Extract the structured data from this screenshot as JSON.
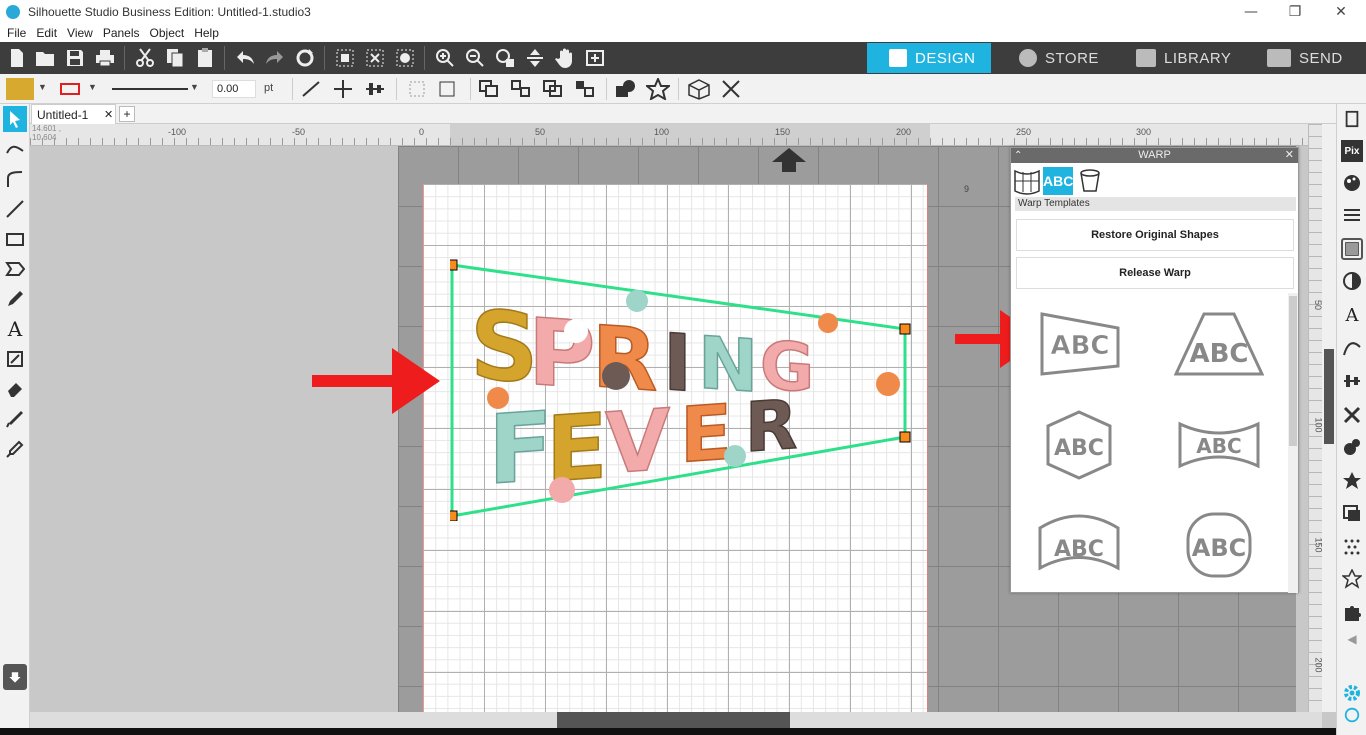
{
  "window": {
    "title": "Silhouette Studio Business Edition: Untitled-1.studio3",
    "minimize": "—",
    "restore": "❐",
    "close": "✕"
  },
  "menu": [
    "File",
    "Edit",
    "View",
    "Panels",
    "Object",
    "Help"
  ],
  "nav_tabs": {
    "design": "DESIGN",
    "store": "STORE",
    "library": "LIBRARY",
    "send": "SEND"
  },
  "line_settings": {
    "width_value": "0.00",
    "unit": "pt"
  },
  "document": {
    "tab_name": "Untitled-1",
    "close_tab": "✕",
    "add_tab": "+",
    "cursor_coords": "14.601 , 10.604"
  },
  "ruler": {
    "h_labels": [
      "-100",
      "-50",
      "0",
      "50",
      "100",
      "150",
      "200",
      "250",
      "300"
    ],
    "v_labels": [
      "50",
      "100",
      "150",
      "200"
    ]
  },
  "design_text": {
    "line1": "SPRING",
    "line2": "FEVER"
  },
  "warp_panel": {
    "title": "WARP",
    "section_label": "Warp Templates",
    "restore_button": "Restore Original Shapes",
    "release_button": "Release Warp",
    "template_text": "ABC"
  },
  "colors": {
    "accent": "#1fb3e0",
    "selection": "#2ee08a",
    "handle": "#f68b1f",
    "arrow": "#ee1c1c",
    "fill_swatch": "#d8a92f",
    "mustard": "#d4a42c",
    "pink": "#f2aaaa",
    "teal": "#9fd4c8",
    "orange": "#f08a4b",
    "brown": "#6e5a55"
  }
}
